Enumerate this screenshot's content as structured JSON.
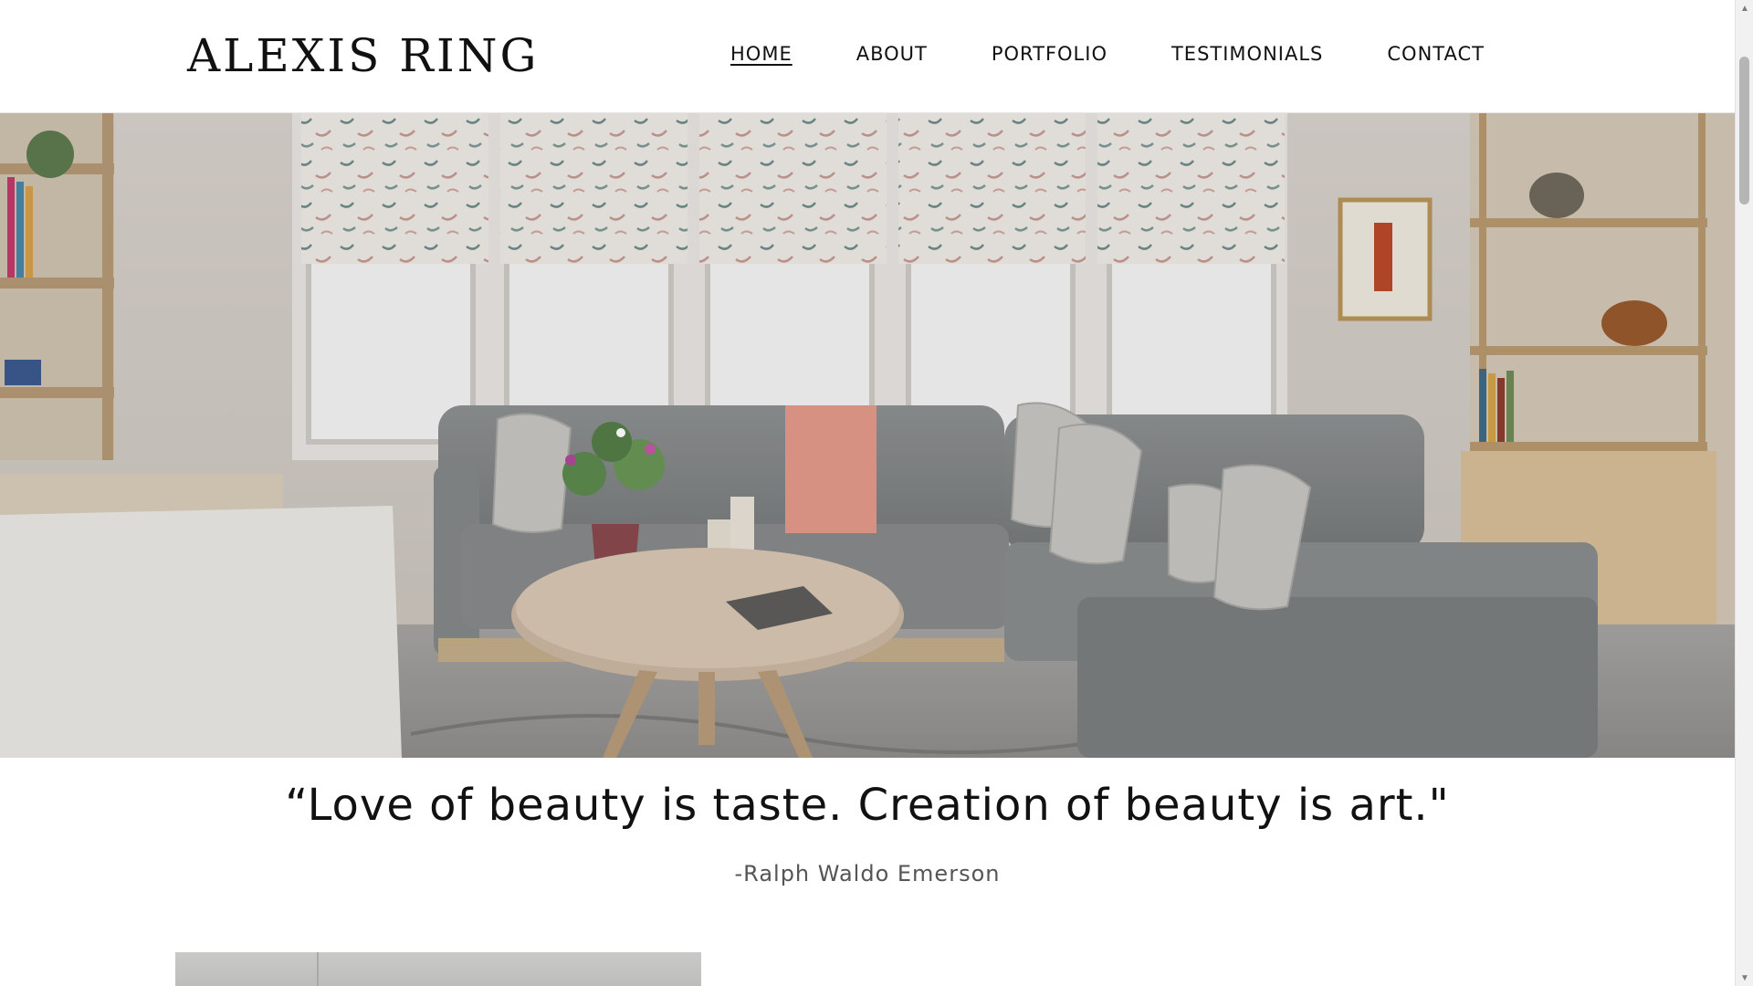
{
  "header": {
    "logo": "ALEXIS RING",
    "nav": [
      {
        "label": "HOME",
        "active": true
      },
      {
        "label": "ABOUT",
        "active": false
      },
      {
        "label": "PORTFOLIO",
        "active": false
      },
      {
        "label": "TESTIMONIALS",
        "active": false
      },
      {
        "label": "CONTACT",
        "active": false
      }
    ]
  },
  "hero": {
    "image_subject": "living-room-interior"
  },
  "quote": {
    "text": "“Love of beauty is taste. Creation of beauty is art.\"",
    "author": "-Ralph Waldo Emerson"
  },
  "icons": {
    "scroll_up": "▲",
    "scroll_down": "▼"
  }
}
